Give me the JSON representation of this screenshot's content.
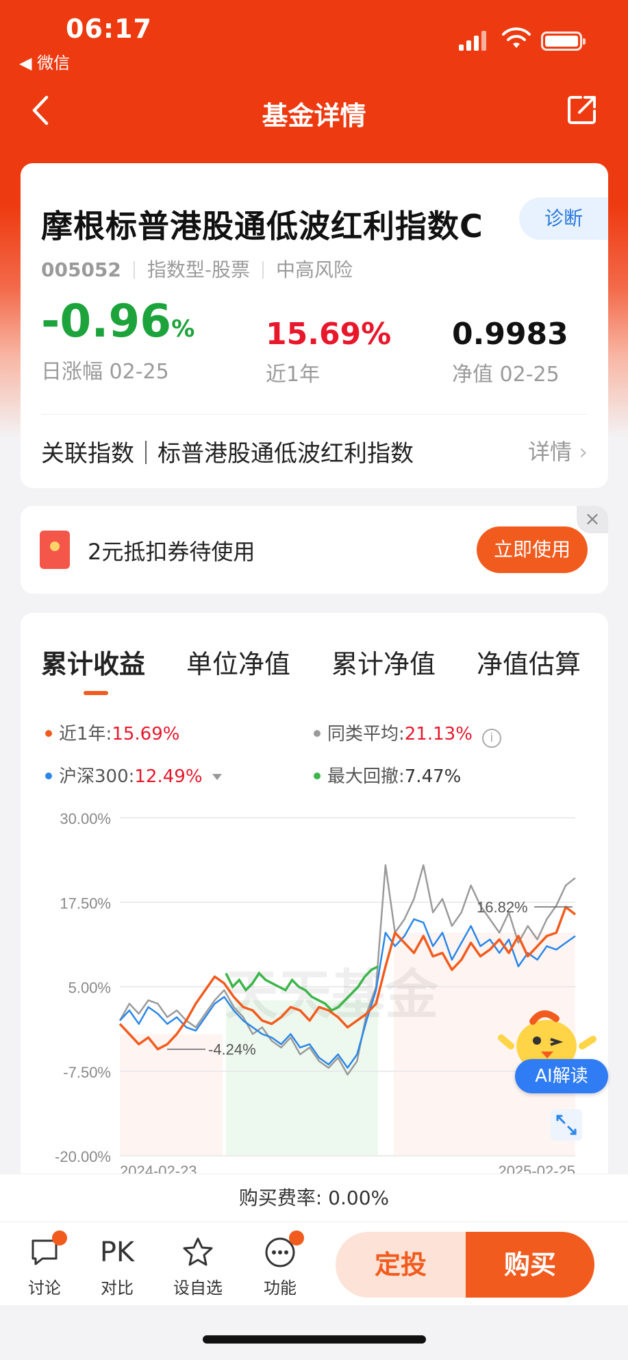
{
  "status_bar": {
    "time": "06:17",
    "back_app": "◀ 微信"
  },
  "nav": {
    "title": "基金详情"
  },
  "fund": {
    "name": "摩根标普港股通低波红利指数C",
    "diagnose_label": "诊断",
    "code": "005052",
    "type": "指数型-股票",
    "risk": "中高风险",
    "daily_change_value": "-0.96",
    "daily_change_unit": "%",
    "daily_change_label": "日涨幅 02-25",
    "year_return_value": "15.69%",
    "year_return_label": "近1年",
    "nav_value": "0.9983",
    "nav_label": "净值 02-25",
    "index_text": "关联指数｜标普港股通低波红利指数",
    "detail_label": "详情"
  },
  "coupon": {
    "text": "2元抵扣券待使用",
    "button": "立即使用",
    "close": "×"
  },
  "tabs": [
    "累计收益",
    "单位净值",
    "累计净值",
    "净值估算"
  ],
  "legend": {
    "fund_label": "近1年:",
    "fund_value": "15.69%",
    "avg_label": "同类平均:",
    "avg_value": "21.13%",
    "index_label": "沪深300:",
    "index_value": "12.49%",
    "dd_label": "最大回撤:",
    "dd_value": "7.47%"
  },
  "colors": {
    "fund": "#f25b1e",
    "avg": "#9a9a9a",
    "index": "#2a86e8",
    "drawdown": "#3cb54a"
  },
  "chart_data": {
    "type": "line",
    "y_ticks": [
      "30.00%",
      "17.50%",
      "5.00%",
      "-7.50%",
      "-20.00%"
    ],
    "ylim": [
      -20,
      30
    ],
    "x_labels": [
      "2024-02-23",
      "2025-02-25"
    ],
    "watermark": "天天基金",
    "annotations": [
      {
        "label": "-4.24%",
        "y": -4.24
      },
      {
        "label": "16.82%",
        "y": 16.82
      }
    ],
    "series": [
      {
        "name": "近1年",
        "values": [
          -0.5,
          -2,
          -3.5,
          -2.5,
          -4.24,
          -3.5,
          -2,
          0,
          2.5,
          4.5,
          6.5,
          5.5,
          3.5,
          2,
          1.5,
          0,
          -0.5,
          0.5,
          2,
          1.5,
          0,
          2,
          1.5,
          0.5,
          -1,
          0,
          1,
          2.5,
          8,
          13,
          11.5,
          10,
          12.5,
          9.5,
          10,
          7.5,
          9,
          11.5,
          9.5,
          10.5,
          12,
          10,
          12.5,
          9.5,
          11,
          12.5,
          13,
          16.8,
          15.7
        ]
      },
      {
        "name": "同类平均",
        "values": [
          0,
          2.5,
          1,
          3,
          2.5,
          0.5,
          1.5,
          0,
          -1,
          1,
          3,
          4.5,
          2,
          0.5,
          -2,
          -1,
          -3,
          -4,
          -2.5,
          -5,
          -4,
          -6,
          -7,
          -5.5,
          -8,
          -6,
          1,
          5,
          23,
          13,
          15,
          18,
          23,
          16,
          18,
          14,
          16,
          20,
          17,
          15,
          13,
          16,
          11.5,
          14,
          12,
          15,
          17,
          20,
          21.1
        ]
      },
      {
        "name": "沪深300",
        "values": [
          0,
          1.5,
          -0.5,
          2,
          1,
          -0.5,
          0.5,
          -1,
          -1.5,
          0.5,
          2.5,
          3.5,
          1.5,
          0,
          -1,
          -2,
          -2.5,
          -3.5,
          -2,
          -4,
          -3.5,
          -5.5,
          -6.5,
          -5,
          -7,
          -5,
          0,
          4.5,
          13,
          11,
          12.5,
          15,
          14.5,
          11,
          13,
          9,
          11.5,
          14,
          11,
          12,
          10,
          12,
          8,
          10,
          9,
          11,
          10.5,
          11.5,
          12.5
        ]
      }
    ],
    "drawdown": {
      "name": "最大回撤",
      "value": "7.47%",
      "values": [
        7,
        5,
        6,
        4.5,
        5.5,
        7,
        6,
        5.5,
        5,
        4.5,
        6,
        5,
        4.5,
        3.5,
        3,
        2.5,
        1.5,
        2,
        3,
        4,
        5,
        6.5,
        7.5,
        8
      ]
    }
  },
  "fee": {
    "text": "购买费率: 0.00%"
  },
  "bottom_bar": {
    "items": [
      {
        "label": "讨论"
      },
      {
        "label": "对比",
        "icon_text": "PK"
      },
      {
        "label": "设自选"
      },
      {
        "label": "功能"
      }
    ],
    "auto_invest": "定投",
    "buy": "购买"
  },
  "ai": {
    "label": "AI解读"
  }
}
